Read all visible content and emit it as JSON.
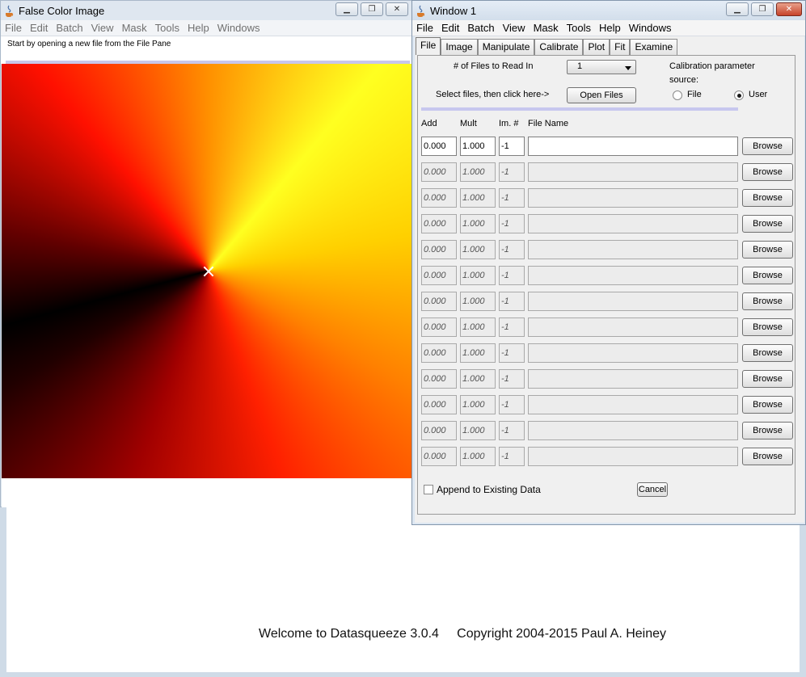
{
  "false_color_window": {
    "title": "False Color Image",
    "menu": [
      "File",
      "Edit",
      "Batch",
      "View",
      "Mask",
      "Tools",
      "Help",
      "Windows"
    ],
    "message": "Start by opening a new file from the File Pane"
  },
  "window1": {
    "title": "Window 1",
    "menu": [
      "File",
      "Edit",
      "Batch",
      "View",
      "Mask",
      "Tools",
      "Help",
      "Windows"
    ],
    "tabs": [
      "File",
      "Image",
      "Manipulate",
      "Calibrate",
      "Plot",
      "Fit",
      "Examine"
    ],
    "active_tab": "File",
    "files_to_read_label": "# of Files to Read In",
    "files_to_read_value": "1",
    "select_label": "Select files, then click here->",
    "open_files_label": "Open Files",
    "calib_label_1": "Calibration parameter",
    "calib_label_2": "source:",
    "radio_file": "File",
    "radio_user": "User",
    "radio_selected": "User",
    "col_add": "Add",
    "col_mult": "Mult",
    "col_im": "Im. #",
    "col_name": "File Name",
    "browse_label": "Browse",
    "rows": [
      {
        "add": "0.000",
        "mult": "1.000",
        "im": "-1",
        "name": "",
        "active": true
      },
      {
        "add": "0.000",
        "mult": "1.000",
        "im": "-1",
        "name": "",
        "active": false
      },
      {
        "add": "0.000",
        "mult": "1.000",
        "im": "-1",
        "name": "",
        "active": false
      },
      {
        "add": "0.000",
        "mult": "1.000",
        "im": "-1",
        "name": "",
        "active": false
      },
      {
        "add": "0.000",
        "mult": "1.000",
        "im": "-1",
        "name": "",
        "active": false
      },
      {
        "add": "0.000",
        "mult": "1.000",
        "im": "-1",
        "name": "",
        "active": false
      },
      {
        "add": "0.000",
        "mult": "1.000",
        "im": "-1",
        "name": "",
        "active": false
      },
      {
        "add": "0.000",
        "mult": "1.000",
        "im": "-1",
        "name": "",
        "active": false
      },
      {
        "add": "0.000",
        "mult": "1.000",
        "im": "-1",
        "name": "",
        "active": false
      },
      {
        "add": "0.000",
        "mult": "1.000",
        "im": "-1",
        "name": "",
        "active": false
      },
      {
        "add": "0.000",
        "mult": "1.000",
        "im": "-1",
        "name": "",
        "active": false
      },
      {
        "add": "0.000",
        "mult": "1.000",
        "im": "-1",
        "name": "",
        "active": false
      },
      {
        "add": "0.000",
        "mult": "1.000",
        "im": "-1",
        "name": "",
        "active": false
      }
    ],
    "append_label": "Append to Existing Data",
    "append_checked": false,
    "cancel_label": "Cancel"
  },
  "main_window": {
    "welcome": "Welcome to Datasqueeze 3.0.4     Copyright 2004-2015 Paul A. Heiney"
  }
}
